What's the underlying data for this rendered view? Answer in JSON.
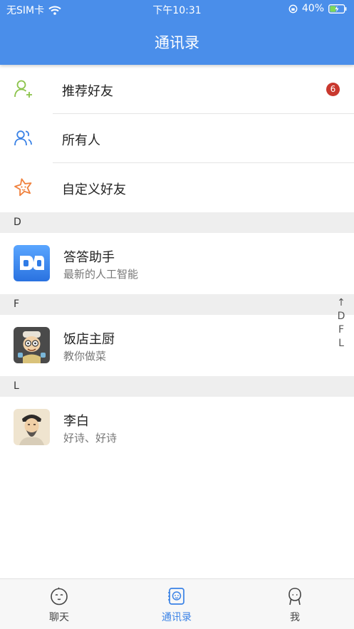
{
  "status_bar": {
    "carrier": "无SIM卡",
    "time": "下午10:31",
    "battery": "40%"
  },
  "header": {
    "title": "通讯录"
  },
  "nav_items": [
    {
      "label": "推荐好友",
      "icon": "add-user-icon",
      "badge": "6"
    },
    {
      "label": "所有人",
      "icon": "users-icon"
    },
    {
      "label": "自定义好友",
      "icon": "star-icon"
    }
  ],
  "sections": [
    {
      "letter": "D",
      "contacts": [
        {
          "name": "答答助手",
          "desc": "最新的人工智能",
          "avatar": "dada-logo"
        }
      ]
    },
    {
      "letter": "F",
      "contacts": [
        {
          "name": "饭店主厨",
          "desc": "教你做菜",
          "avatar": "chef-avatar"
        }
      ]
    },
    {
      "letter": "L",
      "contacts": [
        {
          "name": "李白",
          "desc": "好诗、好诗",
          "avatar": "libai-avatar"
        }
      ]
    }
  ],
  "index_bar": [
    "↑",
    "D",
    "F",
    "L"
  ],
  "tabs": [
    {
      "label": "聊天",
      "icon": "chat-icon",
      "active": false
    },
    {
      "label": "通讯录",
      "icon": "contacts-icon",
      "active": true
    },
    {
      "label": "我",
      "icon": "profile-icon",
      "active": false
    }
  ],
  "colors": {
    "header": "#4a8eea",
    "active_tab": "#3a82e6",
    "badge": "#c9382e",
    "add_user_icon": "#8bc34a",
    "users_icon": "#3a82e6",
    "star_icon": "#f0803c"
  }
}
